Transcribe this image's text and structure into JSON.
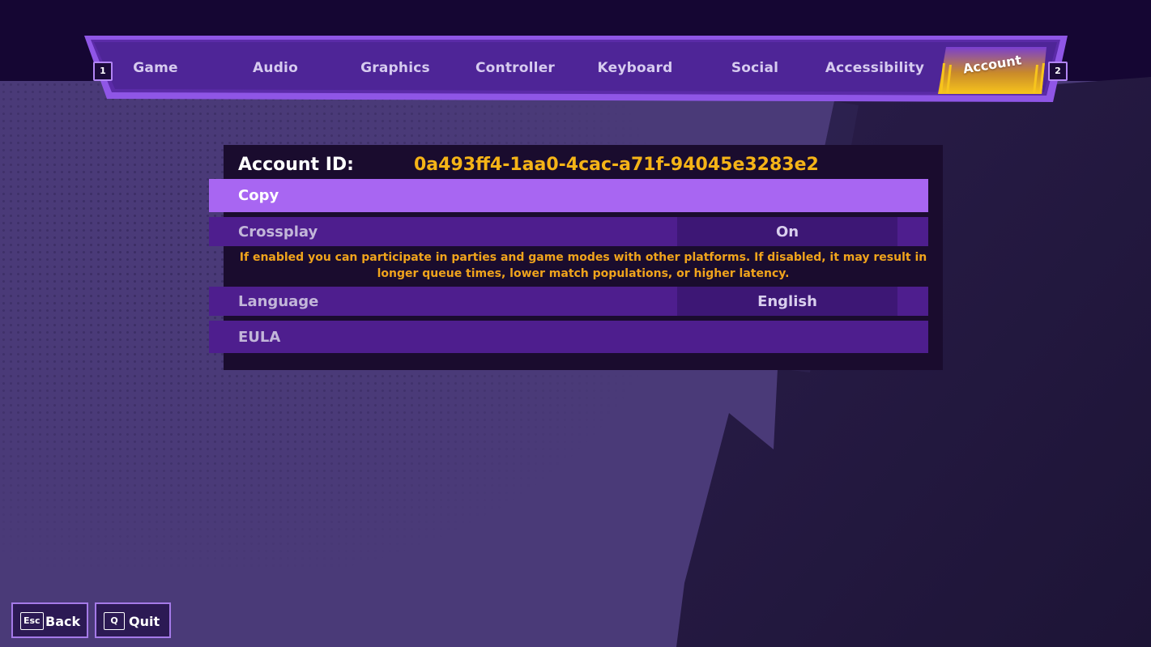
{
  "tabs": {
    "prev_key": "1",
    "next_key": "2",
    "items": [
      {
        "label": "Game"
      },
      {
        "label": "Audio"
      },
      {
        "label": "Graphics"
      },
      {
        "label": "Controller"
      },
      {
        "label": "Keyboard"
      },
      {
        "label": "Social"
      },
      {
        "label": "Accessibility"
      },
      {
        "label": "Account",
        "active": true
      }
    ]
  },
  "account": {
    "id_label": "Account ID:",
    "id_value": "0a493ff4-1aa0-4cac-a71f-94045e3283e2",
    "rows": {
      "copy": {
        "label": "Copy"
      },
      "crossplay": {
        "label": "Crossplay",
        "value": "On"
      },
      "crossplay_description": "If enabled you can participate in parties and game modes with other platforms. If disabled, it may result in longer queue times, lower match populations, or higher latency.",
      "language": {
        "label": "Language",
        "value": "English"
      },
      "eula": {
        "label": "EULA"
      }
    }
  },
  "footer": {
    "back": {
      "key": "Esc",
      "label": "Back"
    },
    "quit": {
      "key": "Q",
      "label": "Quit"
    }
  },
  "colors": {
    "accent_purple": "#a866f2",
    "row_purple": "#4e1e8e",
    "highlight_gold": "#f5b417",
    "panel_dark": "#1a0c2e"
  }
}
